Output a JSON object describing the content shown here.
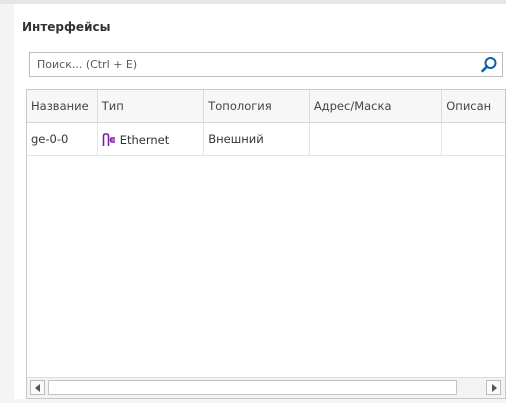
{
  "panel": {
    "title": "Интерфейсы"
  },
  "search": {
    "placeholder": "Поиск... (Ctrl + E)",
    "value": ""
  },
  "table": {
    "columns": [
      "Название",
      "Тип",
      "Топология",
      "Адрес/Маска",
      "Описан"
    ],
    "rows": [
      {
        "name": "ge-0-0",
        "type": "Ethernet",
        "type_icon": "ethernet-icon",
        "topology": "Внешний",
        "address": "",
        "description": ""
      }
    ]
  },
  "colors": {
    "panel_bg": "#ffffff",
    "header_bg": "#f7f7f7",
    "search_icon": "#0d5fb0",
    "ethernet_icon": "#7b1fa2"
  }
}
